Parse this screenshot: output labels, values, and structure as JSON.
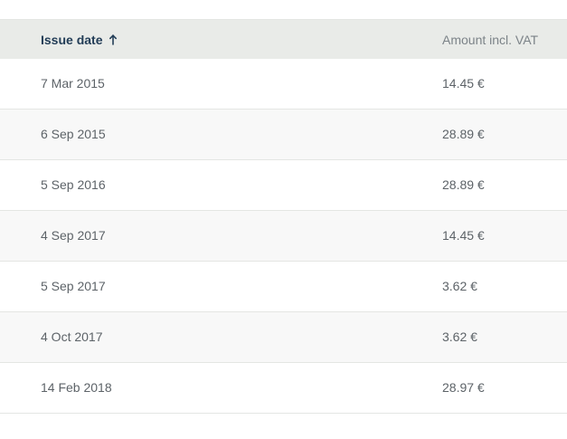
{
  "table": {
    "headers": {
      "issue_date": "Issue date",
      "amount": "Amount incl. VAT",
      "sort_icon": "arrow-up-icon"
    },
    "rows": [
      {
        "issue_date": "7 Mar 2015",
        "amount": "14.45 €"
      },
      {
        "issue_date": "6 Sep 2015",
        "amount": "28.89 €"
      },
      {
        "issue_date": "5 Sep 2016",
        "amount": "28.89 €"
      },
      {
        "issue_date": "4 Sep 2017",
        "amount": "14.45 €"
      },
      {
        "issue_date": "5 Sep 2017",
        "amount": "3.62 €"
      },
      {
        "issue_date": "4 Oct 2017",
        "amount": "3.62 €"
      },
      {
        "issue_date": "14 Feb 2018",
        "amount": "28.97 €"
      }
    ]
  },
  "colors": {
    "header_background": "#e9ebe8",
    "header_active_text": "#233d57",
    "header_inactive_text": "#7c8388",
    "body_text": "#5d6368",
    "row_stripe": "#f8f8f8",
    "divider": "#e4e6e3"
  }
}
